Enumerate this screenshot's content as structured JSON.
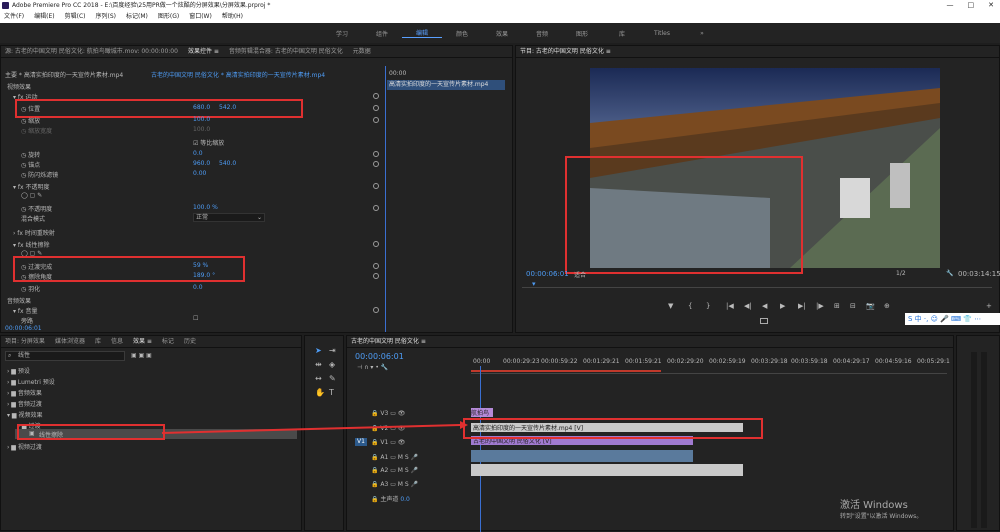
{
  "window": {
    "title": "Adobe Premiere Pro CC 2018 - E:\\百度经验\\25用PR做一个炫酷的分屏效果\\分屏效果.prproj *",
    "controls": [
      "—",
      "□",
      "✕"
    ]
  },
  "menu": [
    "文件(F)",
    "编辑(E)",
    "剪辑(C)",
    "序列(S)",
    "标记(M)",
    "图形(G)",
    "窗口(W)",
    "帮助(H)"
  ],
  "workspaces": [
    {
      "label": "学习"
    },
    {
      "label": "组件"
    },
    {
      "label": "编辑",
      "active": true
    },
    {
      "label": "颜色"
    },
    {
      "label": "效果"
    },
    {
      "label": "音频"
    },
    {
      "label": "图形"
    },
    {
      "label": "库"
    },
    {
      "label": "Titles"
    },
    {
      "label": "»"
    }
  ],
  "source_panel": {
    "tabs": [
      "源: 古老的中国文明 民俗文化: 航拍鸟瞰城市.mov: 00:00:00:00",
      "效果控件 ≡",
      "音频剪辑混合器: 古老的中国文明 民俗文化",
      "元数据"
    ],
    "master": "主要 * 高清实拍印度的一天宣传片素材.mp4",
    "clip": "古老的中国文明 民俗文化 * 高清实拍印度的一天宣传片素材.mp4",
    "timeline_clip": "高清实拍印度的一天宣传片素材.mp4",
    "ruler_time": "00:00",
    "video_effects": "视频效果",
    "motion": "运动",
    "position_label": "位置",
    "position_x": "680.0",
    "position_y": "542.0",
    "scale_label": "缩放",
    "scale_value": "100.0",
    "scale_width_label": "缩放宽度",
    "scale_width_value": "100.0",
    "uniform_scale": "等比缩放",
    "rotation_label": "旋转",
    "rotation_value": "0.0",
    "anchor_label": "锚点",
    "anchor_x": "960.0",
    "anchor_y": "540.0",
    "antiflicker_label": "防闪烁滤镜",
    "antiflicker_value": "0.00",
    "opacity": "不透明度",
    "opacity_label": "不透明度",
    "opacity_value": "100.0 %",
    "blend_label": "混合模式",
    "blend_value": "正常",
    "time_remap": "时间重映射",
    "linear_wipe": "线性擦除",
    "completion_label": "过渡完成",
    "completion_value": "59 %",
    "angle_label": "擦除角度",
    "angle_value": "189.0 °",
    "feather_label": "羽化",
    "feather_value": "0.0",
    "audio_effects": "音频效果",
    "volume": "音量",
    "bypass_label": "旁路",
    "timecode": "00:00:06:01"
  },
  "program_panel": {
    "title": "节目: 古老的中国文明 民俗文化 ≡",
    "timecode": "00:00:06:01",
    "fit": "适合",
    "zoom": "1/2",
    "duration": "00:03:14:15",
    "controls": [
      "▼",
      "{",
      "}",
      "|◀",
      "◀|",
      "◀",
      "▶",
      "▶|",
      "|▶",
      "⊞",
      "⊟",
      "📷",
      "⊕",
      "+"
    ]
  },
  "project_panel": {
    "tabs": [
      "项目: 分屏效果",
      "媒体浏览器",
      "库",
      "信息",
      "效果 ≡",
      "标记",
      "历史"
    ],
    "search_value": "线性",
    "folders": [
      {
        "label": "预设",
        "depth": 0
      },
      {
        "label": "Lumetri 预设",
        "depth": 0
      },
      {
        "label": "音频效果",
        "depth": 0
      },
      {
        "label": "音频过渡",
        "depth": 0
      },
      {
        "label": "视频效果",
        "depth": 0
      },
      {
        "label": "过渡",
        "depth": 1
      },
      {
        "label": "线性擦除",
        "depth": 2,
        "selected": true
      },
      {
        "label": "视频过渡",
        "depth": 0
      }
    ]
  },
  "timeline_panel": {
    "title": "古老的中国文明 民俗文化 ≡",
    "timecode": "00:00:06:01",
    "ruler": [
      "00:00",
      "00:00:29:23",
      "00:00:59:22",
      "00:01:29:21",
      "00:01:59:21",
      "00:02:29:20",
      "00:02:59:19",
      "00:03:29:18",
      "00:03:59:18",
      "00:04:29:17",
      "00:04:59:16",
      "00:05:29:1"
    ],
    "tracks": [
      {
        "name": "V3",
        "clip": "航拍鸟"
      },
      {
        "name": "V2",
        "clip": "高清实拍印度的一天宣传片素材.mp4 [V]"
      },
      {
        "name": "V1",
        "clip": "古老的中国文明 民俗文化 [V]"
      },
      {
        "name": "A1"
      },
      {
        "name": "A2"
      },
      {
        "name": "A3"
      }
    ],
    "master_label": "主声道",
    "master_value": "0.0"
  },
  "watermark": {
    "line1": "激活 Windows",
    "line2": "转到\"设置\"以激活 Windows。"
  },
  "ime": "S 中 ·, ☺ 🎤 ⌨ 👕 ⋯"
}
